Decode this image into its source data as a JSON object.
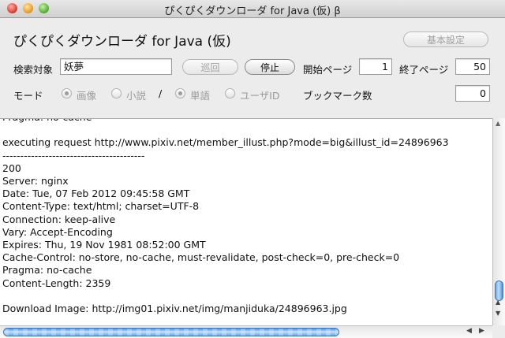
{
  "window": {
    "title": "ぴくぴくダウンローダ for Java (仮) β",
    "controls": [
      "close-icon",
      "minimize-icon",
      "zoom-icon"
    ]
  },
  "header": {
    "app_title": "ぴくぴくダウンローダ for Java (仮)",
    "settings_label": "基本設定"
  },
  "search": {
    "target_label": "検索対象",
    "target_value": "妖夢",
    "patrol_label": "巡回",
    "stop_label": "停止",
    "start_page_label": "開始ページ",
    "start_page_value": "1",
    "end_page_label": "終了ページ",
    "end_page_value": "50"
  },
  "mode": {
    "label": "モード",
    "options_a": [
      {
        "label": "画像",
        "selected": true
      },
      {
        "label": "小説",
        "selected": false
      }
    ],
    "separator": "/",
    "options_b": [
      {
        "label": "単語",
        "selected": true
      },
      {
        "label": "ユーザID",
        "selected": false
      }
    ],
    "bookmark_label": "ブックマーク数",
    "bookmark_value": "0"
  },
  "log": {
    "lines": [
      "Pragma: no-cache",
      "",
      "executing request http://www.pixiv.net/member_illust.php?mode=big&illust_id=24896963",
      "----------------------------------------",
      "200",
      "Server: nginx",
      "Date: Tue, 07 Feb 2012 09:45:58 GMT",
      "Content-Type: text/html; charset=UTF-8",
      "Connection: keep-alive",
      "Vary: Accept-Encoding",
      "Expires: Thu, 19 Nov 1981 08:52:00 GMT",
      "Cache-Control: no-store, no-cache, must-revalidate, post-check=0, pre-check=0",
      "Pragma: no-cache",
      "Content-Length: 2359",
      "",
      "Download Image: http://img01.pixiv.net/img/manjiduka/24896963.jpg"
    ]
  }
}
